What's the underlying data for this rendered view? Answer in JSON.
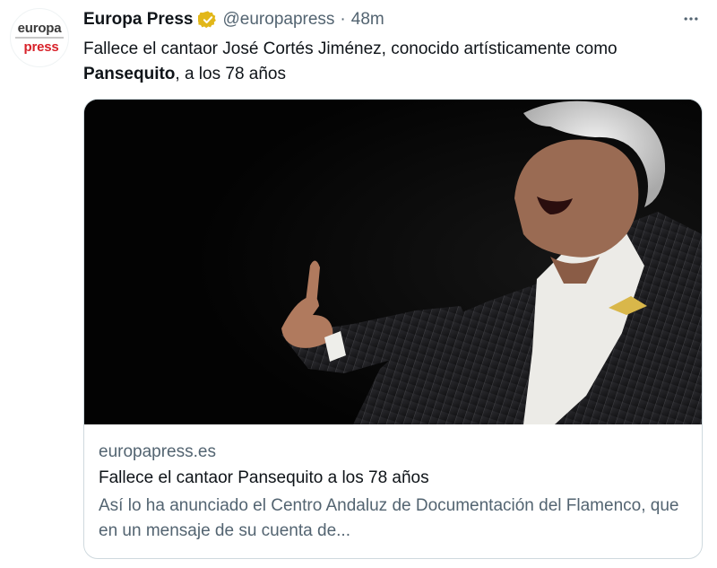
{
  "account": {
    "avatar_line1": "europa",
    "avatar_line2": "press",
    "name": "Europa Press",
    "handle": "@europapress",
    "separator": "·",
    "time": "48m",
    "verified_badge_color": "#e2b719"
  },
  "tweet": {
    "text_part1": "Fallece el cantaor José Cortés Jiménez, conocido artísticamente como ",
    "text_bold": "Pansequito",
    "text_part2": ", a los 78 años"
  },
  "card": {
    "image_description_icon": "photo",
    "domain": "europapress.es",
    "title": "Fallece el cantaor Pansequito a los 78 años",
    "description": "Así lo ha anunciado el Centro Andaluz de Documentación del Flamenco, que en un mensaje de su cuenta de..."
  },
  "icons": {
    "more": "more-horizontal-icon",
    "badge": "verified-badge-icon"
  }
}
